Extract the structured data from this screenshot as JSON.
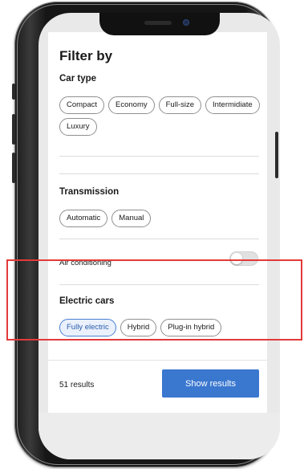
{
  "filter": {
    "title": "Filter by",
    "car_type": {
      "heading": "Car type",
      "options": [
        "Compact",
        "Economy",
        "Full-size",
        "Intermidiate",
        "Luxury"
      ]
    },
    "transmission": {
      "heading": "Transmission",
      "options": [
        "Automatic",
        "Manual"
      ]
    },
    "air_conditioning": {
      "label": "Air conditioning",
      "enabled": false
    },
    "electric_cars": {
      "heading": "Electric cars",
      "options": [
        "Fully electric",
        "Hybrid",
        "Plug-in hybrid"
      ],
      "selected": "Fully electric"
    }
  },
  "footer": {
    "results_count": "51 results",
    "show_results_label": "Show results"
  },
  "colors": {
    "accent": "#3a77cf",
    "selected_chip_border": "#4a7fd3",
    "highlight": "#e23a3a"
  }
}
